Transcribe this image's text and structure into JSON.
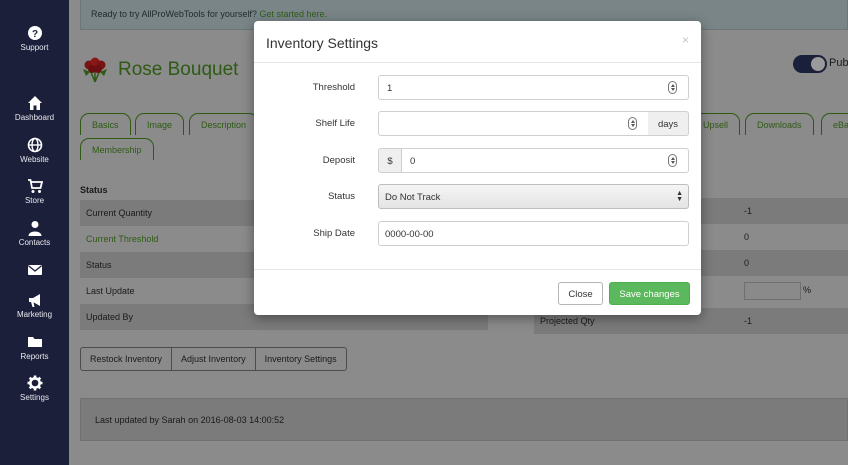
{
  "sidebar": {
    "items": [
      {
        "label": "Support",
        "icon": "question-circle-icon"
      },
      {
        "label": "Dashboard",
        "icon": "home-icon"
      },
      {
        "label": "Website",
        "icon": "globe-icon"
      },
      {
        "label": "Store",
        "icon": "cart-icon"
      },
      {
        "label": "Contacts",
        "icon": "user-icon"
      },
      {
        "label": "",
        "icon": "envelope-icon"
      },
      {
        "label": "Marketing",
        "icon": "megaphone-icon"
      },
      {
        "label": "Reports",
        "icon": "folder-icon"
      },
      {
        "label": "Settings",
        "icon": "gear-icon"
      }
    ]
  },
  "banner": {
    "text": "Ready to try AllProWebTools for yourself?",
    "link": "Get started here."
  },
  "product": {
    "title": "Rose Bouquet",
    "publish_label": "Pub"
  },
  "tabs": {
    "row1": [
      "Basics",
      "Image",
      "Description",
      "Upsell",
      "Downloads",
      "eBa"
    ],
    "row2": [
      "Membership"
    ]
  },
  "status": {
    "heading": "Status",
    "rows": [
      {
        "label": "Current Quantity"
      },
      {
        "label": "Current Threshold"
      },
      {
        "label": "Status"
      },
      {
        "label": "Last Update"
      },
      {
        "label": "Updated By"
      }
    ],
    "right_values": [
      "-1",
      "0",
      "0",
      "-1"
    ],
    "projected_label": "Projected Qty",
    "percent_symbol": "%"
  },
  "inventory_buttons": [
    "Restock Inventory",
    "Adjust Inventory",
    "Inventory Settings"
  ],
  "footer": {
    "text": "Last updated by Sarah on 2016-08-03 14:00:52"
  },
  "modal": {
    "title": "Inventory Settings",
    "close_symbol": "×",
    "fields": {
      "threshold": {
        "label": "Threshold",
        "value": "1"
      },
      "shelf_life": {
        "label": "Shelf Life",
        "value": "",
        "unit": "days"
      },
      "deposit": {
        "label": "Deposit",
        "prefix": "$",
        "value": "0"
      },
      "status": {
        "label": "Status",
        "value": "Do Not Track"
      },
      "ship_date": {
        "label": "Ship Date",
        "value": "0000-00-00"
      }
    },
    "buttons": {
      "close": "Close",
      "save": "Save changes"
    }
  },
  "colors": {
    "sidebar_bg": "#1b1f3a",
    "brand_green": "#5cb85c",
    "tab_green": "#2e5a14"
  }
}
